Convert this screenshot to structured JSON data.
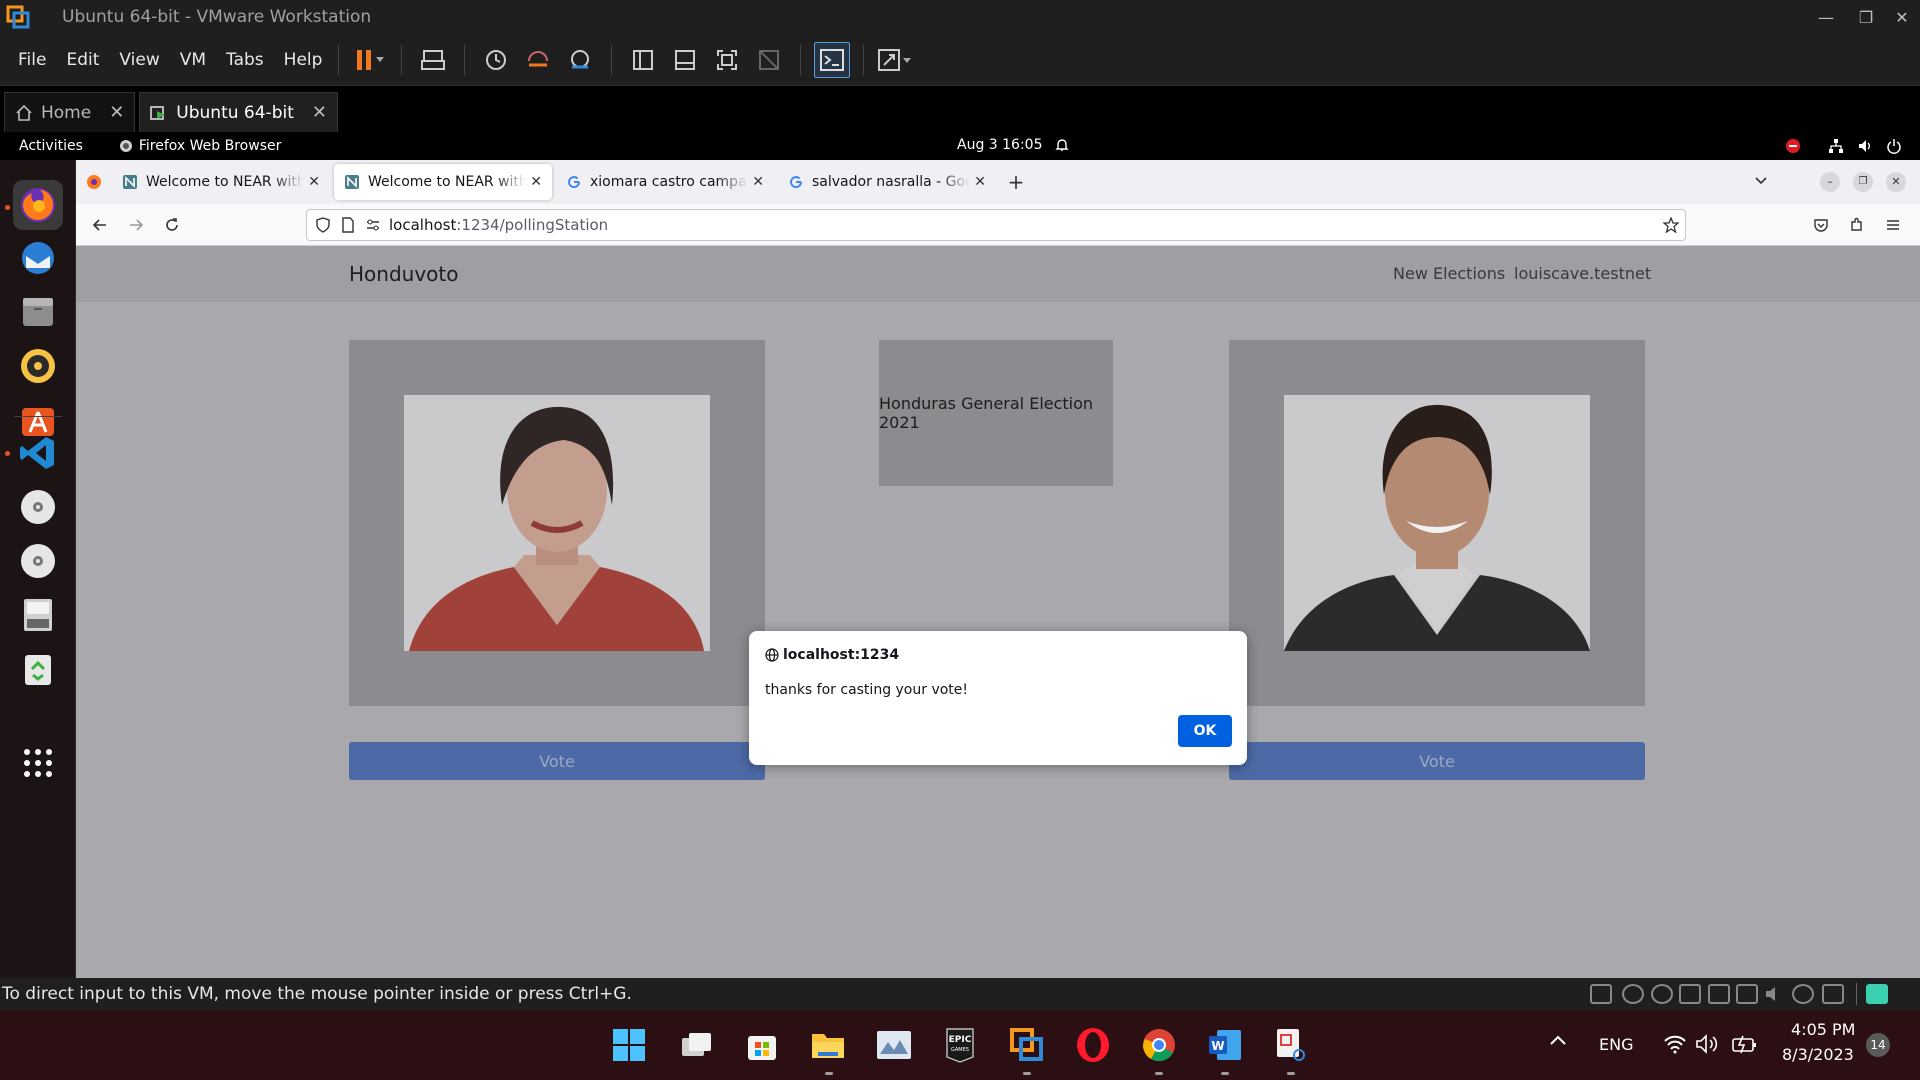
{
  "vmware": {
    "title": "Ubuntu 64-bit - VMware Workstation",
    "menus": [
      "File",
      "Edit",
      "View",
      "VM",
      "Tabs",
      "Help"
    ],
    "tabs": [
      {
        "label": "Home"
      },
      {
        "label": "Ubuntu 64-bit"
      }
    ],
    "status_message": "To direct input to this VM, move the mouse pointer inside or press Ctrl+G."
  },
  "gnome": {
    "activities": "Activities",
    "app_name": "Firefox Web Browser",
    "clock": "Aug 3  16:05"
  },
  "firefox": {
    "tabs": [
      {
        "label": "Welcome to NEAR with React",
        "favicon": "near-icon"
      },
      {
        "label": "Welcome to NEAR with React",
        "favicon": "near-icon",
        "active": true
      },
      {
        "label": "xiomara castro campaña",
        "favicon": "google-icon"
      },
      {
        "label": "salvador nasralla - Google Search",
        "favicon": "google-icon"
      }
    ],
    "url_host": "localhost",
    "url_path": ":1234/pollingStation"
  },
  "site": {
    "brand": "Honduvoto",
    "nav_new_elections": "New Elections",
    "nav_account": "louiscave.testnet",
    "election_title": "Honduras General Election 2021",
    "vote_label": "Vote"
  },
  "alert": {
    "origin": "localhost:1234",
    "message": "thanks for casting your vote!",
    "ok_label": "OK"
  },
  "taskbar": {
    "lang": "ENG",
    "time": "4:05 PM",
    "date": "8/3/2023",
    "notifications": "14"
  },
  "colors": {
    "ubuntu_orange": "#e95420",
    "firefox_blue": "#0061e0",
    "vote_button": "#4d6aa6"
  }
}
